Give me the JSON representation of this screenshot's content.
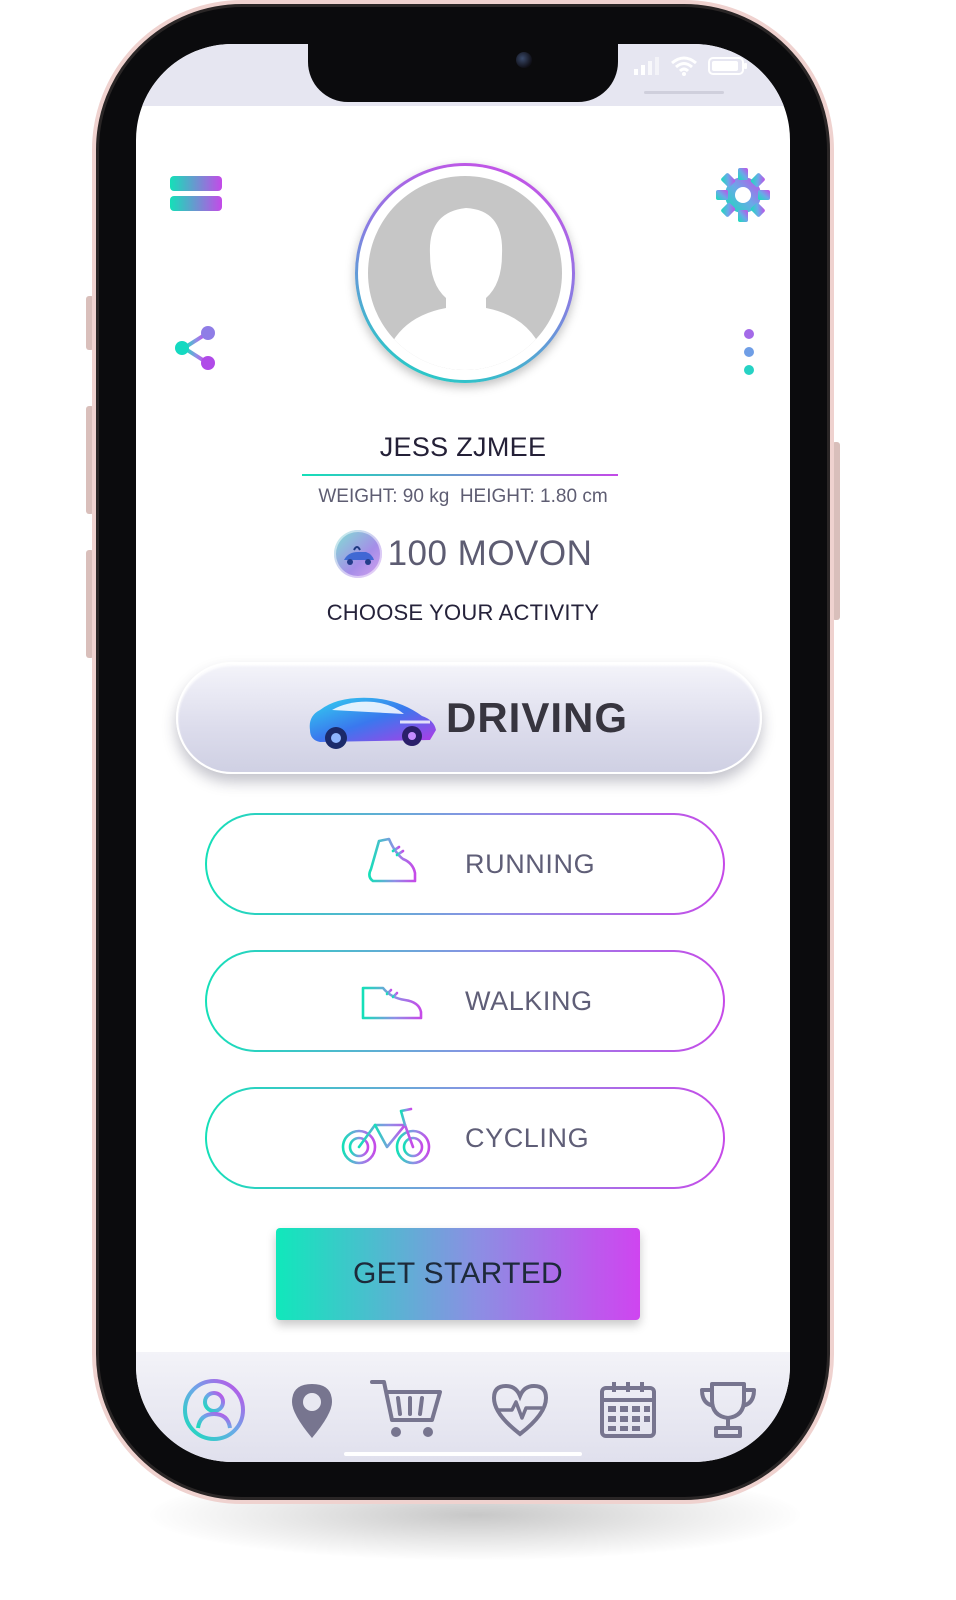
{
  "profile": {
    "name": "JESS ZJMEE",
    "weight": "WEIGHT: 90 kg",
    "height": "HEIGHT: 1.80 cm",
    "coins": "100 MOVON"
  },
  "activity_prompt": "CHOOSE YOUR ACTIVITY",
  "activities": [
    {
      "label": "DRIVING",
      "icon": "car-icon",
      "selected": true
    },
    {
      "label": "RUNNING",
      "icon": "running-shoe-icon",
      "selected": false
    },
    {
      "label": "WALKING",
      "icon": "walking-shoe-icon",
      "selected": false
    },
    {
      "label": "CYCLING",
      "icon": "bicycle-icon",
      "selected": false
    }
  ],
  "cta": {
    "label": "GET STARTED"
  },
  "header_icons": [
    "menu-icon",
    "gear-icon",
    "share-icon",
    "more-vertical-icon"
  ],
  "bottom_nav": [
    {
      "icon": "profile-icon",
      "active": true
    },
    {
      "icon": "location-pin-icon",
      "active": false
    },
    {
      "icon": "cart-icon",
      "active": false
    },
    {
      "icon": "heart-pulse-icon",
      "active": false
    },
    {
      "icon": "calendar-icon",
      "active": false
    },
    {
      "icon": "trophy-icon",
      "active": false
    }
  ],
  "colors": {
    "gradient_start": "#14e0b8",
    "gradient_end": "#c64ae8",
    "text_dark": "#25223a",
    "text_muted": "#5f5e77",
    "nav_icon": "#77758f"
  }
}
